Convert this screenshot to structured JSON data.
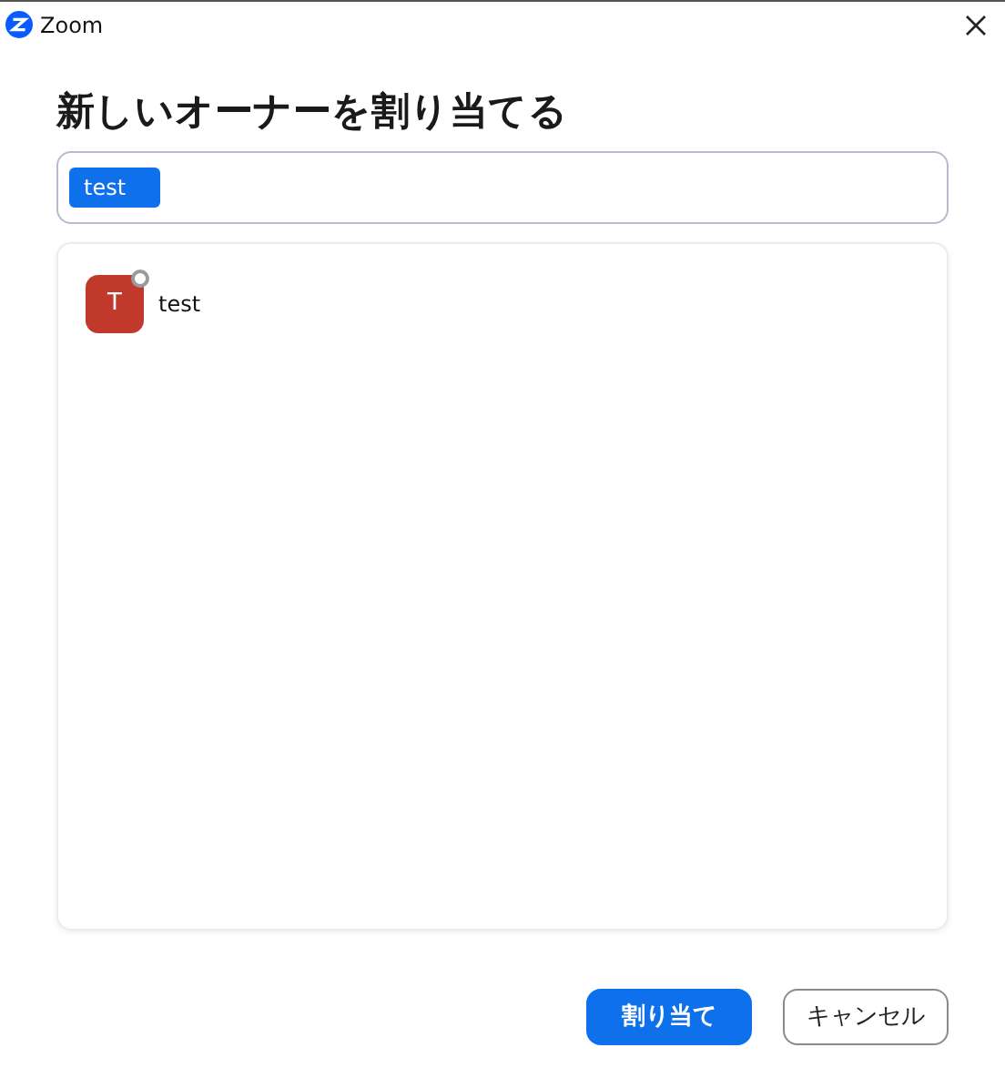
{
  "window": {
    "title": "Zoom"
  },
  "heading": "新しいオーナーを割り当てる",
  "search": {
    "chips": [
      "test"
    ]
  },
  "users": [
    {
      "initial": "T",
      "name": "test",
      "color": "#c0392b",
      "online": false
    }
  ],
  "buttons": [
    {
      "label": "割り当て",
      "kind": "primary"
    },
    {
      "label": "キャンセル",
      "kind": "secondary"
    }
  ]
}
